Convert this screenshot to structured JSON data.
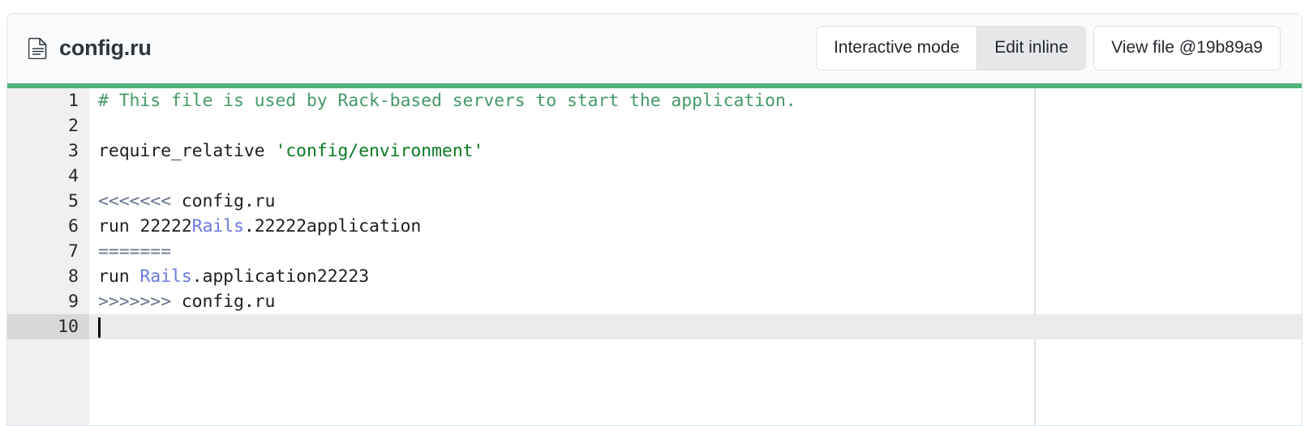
{
  "file": {
    "name": "config.ru",
    "icon": "document-icon"
  },
  "header": {
    "buttons": [
      {
        "label": "Interactive mode",
        "selected": false
      },
      {
        "label": "Edit inline",
        "selected": true
      }
    ],
    "view_file_button": "View file @19b89a9"
  },
  "colors": {
    "accent_green": "#4fb47a",
    "comment_green": "#45996a",
    "string_green": "#0c7a24",
    "constant_blue": "#6b79dd",
    "marker_slate": "#67748c",
    "gutter_bg": "#f0f0f0",
    "active_line_bg": "#ebebeb"
  },
  "editor": {
    "active_line": 10,
    "cursor_line": 10,
    "lines": [
      {
        "n": "1",
        "segments": [
          {
            "t": "# This file is used by Rack-based servers to start the application.",
            "c": "tok-comment"
          }
        ]
      },
      {
        "n": "2",
        "segments": [
          {
            "t": "",
            "c": "tok-plain"
          }
        ]
      },
      {
        "n": "3",
        "segments": [
          {
            "t": "require_relative ",
            "c": "tok-plain"
          },
          {
            "t": "'config/environment'",
            "c": "tok-string"
          }
        ]
      },
      {
        "n": "4",
        "segments": [
          {
            "t": "",
            "c": "tok-plain"
          }
        ]
      },
      {
        "n": "5",
        "segments": [
          {
            "t": "<<<<<<<",
            "c": "tok-marker"
          },
          {
            "t": " config.ru",
            "c": "tok-plain"
          }
        ]
      },
      {
        "n": "6",
        "segments": [
          {
            "t": "run 22222",
            "c": "tok-plain"
          },
          {
            "t": "Rails",
            "c": "tok-const"
          },
          {
            "t": ".22222application",
            "c": "tok-plain"
          }
        ]
      },
      {
        "n": "7",
        "segments": [
          {
            "t": "=======",
            "c": "tok-marker"
          }
        ]
      },
      {
        "n": "8",
        "segments": [
          {
            "t": "run ",
            "c": "tok-plain"
          },
          {
            "t": "Rails",
            "c": "tok-const"
          },
          {
            "t": ".application22223",
            "c": "tok-plain"
          }
        ]
      },
      {
        "n": "9",
        "segments": [
          {
            "t": ">>>>>>>",
            "c": "tok-marker"
          },
          {
            "t": " config.ru",
            "c": "tok-plain"
          }
        ]
      },
      {
        "n": "10",
        "segments": [
          {
            "t": "",
            "c": "tok-plain"
          }
        ]
      }
    ]
  }
}
